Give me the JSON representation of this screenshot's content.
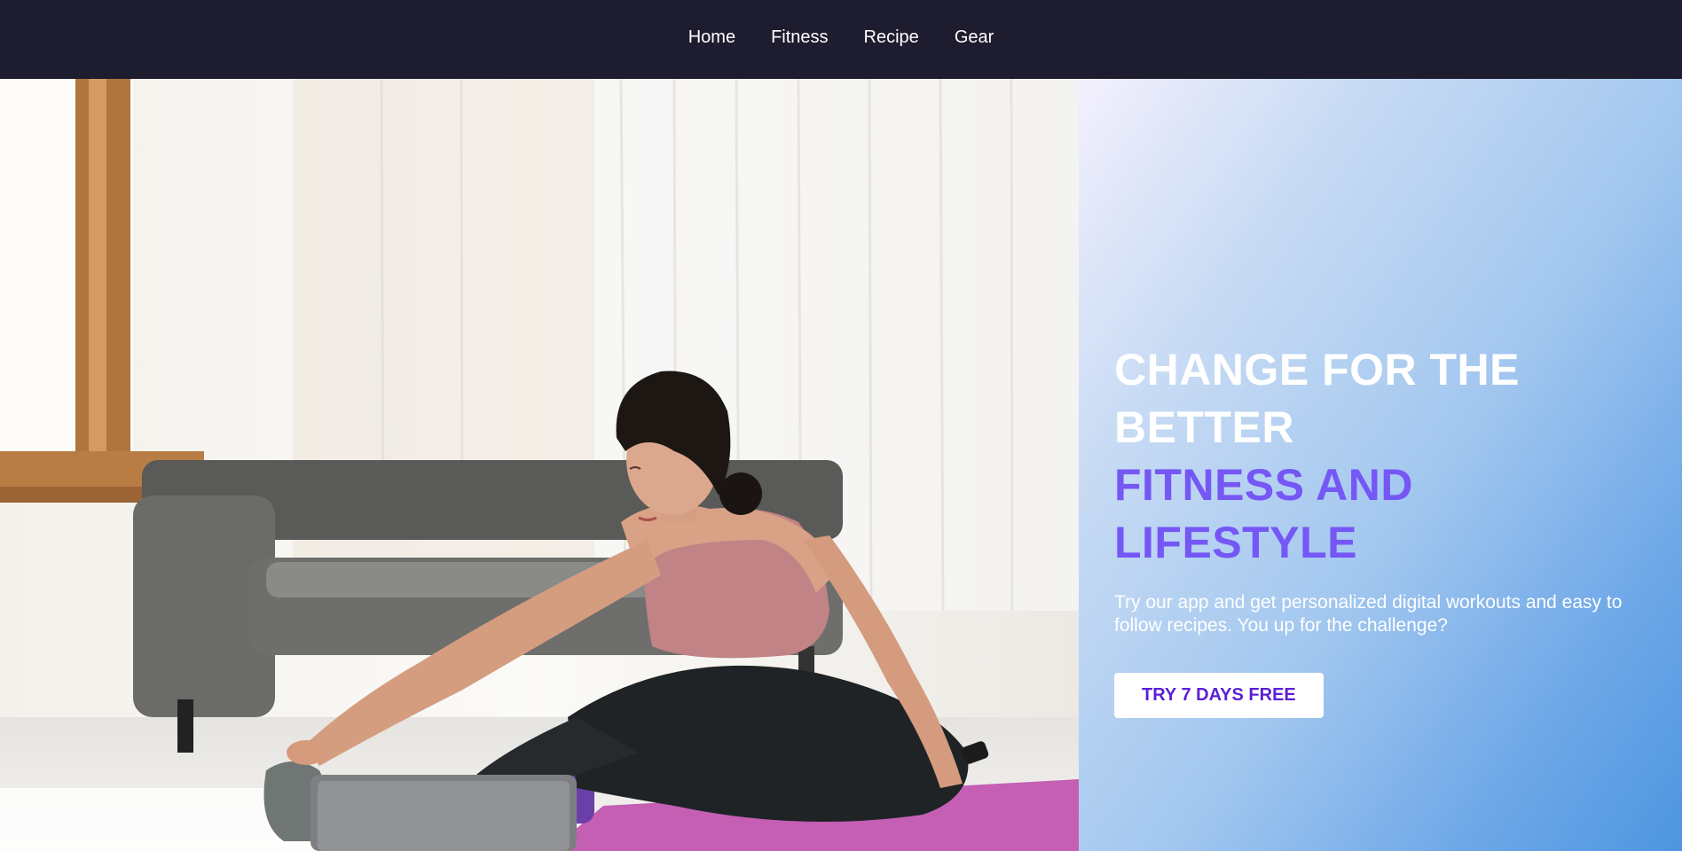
{
  "nav": {
    "items": [
      {
        "label": "Home"
      },
      {
        "label": "Fitness"
      },
      {
        "label": "Recipe"
      },
      {
        "label": "Gear"
      }
    ]
  },
  "hero": {
    "headline_line1": "CHANGE FOR THE",
    "headline_line2": "BETTER",
    "headline_line3": "FITNESS AND",
    "headline_line4": "LIFESTYLE",
    "subtext": "Try our app and get personalized digital workouts and easy to follow recipes. You up for the challenge?",
    "cta_label": "TRY 7 DAYS FREE"
  },
  "colors": {
    "navbar_bg": "#1e1d2f",
    "headline_white": "#ffffff",
    "headline_purple": "#7557f6",
    "cta_text": "#5b1fd4",
    "panel_gradient_end": "#4d96e0"
  }
}
